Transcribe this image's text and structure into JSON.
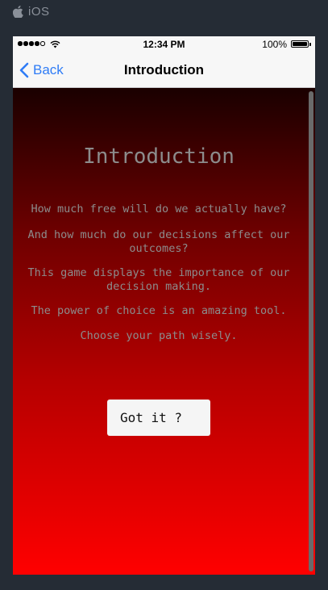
{
  "platform": {
    "icon": "apple-icon",
    "label": "iOS"
  },
  "status_bar": {
    "time": "12:34 PM",
    "battery": "100%",
    "signal_bars_filled": 4,
    "signal_bars_total": 5
  },
  "nav": {
    "back_label": "Back",
    "title": "Introduction"
  },
  "content": {
    "heading": "Introduction",
    "paragraphs": [
      "How much free will do we actually have?",
      "And how much do our decisions affect our outcomes?",
      "This game displays the importance of our decision making.",
      "The power of choice is an amazing tool.",
      "Choose your path wisely."
    ],
    "button_label": "Got it ?"
  },
  "colors": {
    "accent": "#2f7cf6",
    "gradient_top": "#1a0000",
    "gradient_bottom": "#ff0000",
    "text_muted": "#8c8c8c"
  }
}
